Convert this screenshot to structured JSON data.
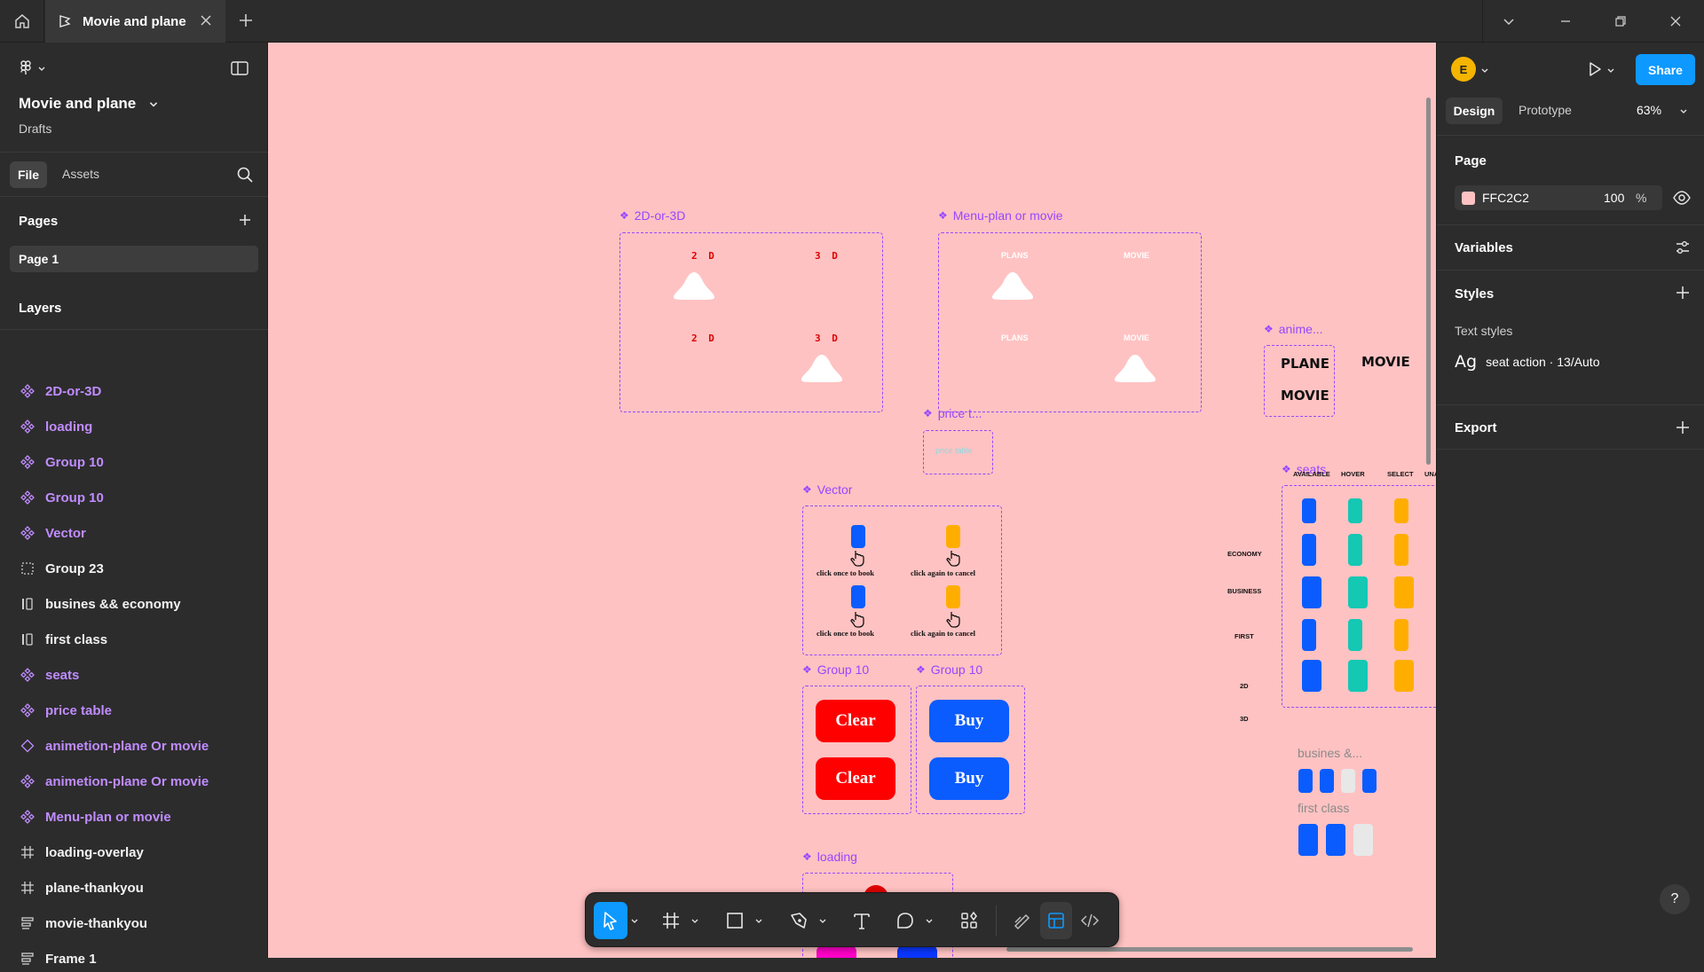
{
  "app": {
    "tab_title": "Movie and plane",
    "project_title": "Movie and plane",
    "project_location": "Drafts"
  },
  "left_panel": {
    "tabs": [
      "File",
      "Assets"
    ],
    "pages_heading": "Pages",
    "pages": [
      "Page 1"
    ],
    "layers_heading": "Layers",
    "layers": [
      {
        "name": "2D-or-3D",
        "icon": "component-icon",
        "color": "purple"
      },
      {
        "name": "loading",
        "icon": "component-icon",
        "color": "purple"
      },
      {
        "name": "Group 10",
        "icon": "component-icon",
        "color": "purple"
      },
      {
        "name": "Group 10",
        "icon": "component-icon",
        "color": "purple"
      },
      {
        "name": "Vector",
        "icon": "component-icon",
        "color": "purple"
      },
      {
        "name": "Group 23",
        "icon": "group-icon",
        "color": "white"
      },
      {
        "name": "busines && economy",
        "icon": "auto-layout-icon",
        "color": "white"
      },
      {
        "name": "first class",
        "icon": "auto-layout-icon",
        "color": "white"
      },
      {
        "name": "seats",
        "icon": "component-icon",
        "color": "purple"
      },
      {
        "name": "price table",
        "icon": "component-icon",
        "color": "purple"
      },
      {
        "name": "animetion-plane Or movie",
        "icon": "instance-icon",
        "color": "purple"
      },
      {
        "name": "animetion-plane Or movie",
        "icon": "component-icon",
        "color": "purple"
      },
      {
        "name": "Menu-plan or movie",
        "icon": "component-icon",
        "color": "purple"
      },
      {
        "name": "loading-overlay",
        "icon": "frame-icon",
        "color": "white"
      },
      {
        "name": "plane-thankyou",
        "icon": "frame-icon",
        "color": "white"
      },
      {
        "name": "movie-thankyou",
        "icon": "auto-layout-row-icon",
        "color": "white"
      },
      {
        "name": "Frame 1",
        "icon": "auto-layout-row-icon",
        "color": "white"
      }
    ]
  },
  "canvas": {
    "background": "#FFC2C2",
    "frames": {
      "twod": {
        "label": "2D-or-3D",
        "texts": [
          "2 D",
          "3 D",
          "2 D",
          "3 D"
        ]
      },
      "menu": {
        "label": "Menu-plan or movie",
        "texts": [
          "PLANS",
          "MOVIE",
          "PLANS",
          "MOVIE"
        ]
      },
      "anime": {
        "label": "anime...",
        "texts": [
          "PLANE",
          "MOVIE",
          "MOVIE"
        ]
      },
      "price": {
        "label": "price t...",
        "text": "price table"
      },
      "vector": {
        "label": "Vector",
        "captions": [
          "click once to book",
          "click again to cancel",
          "click once to book",
          "click again to cancel"
        ]
      },
      "group10a": {
        "label": "Group 10",
        "buttons": [
          "Clear",
          "Clear"
        ]
      },
      "group10b": {
        "label": "Group 10",
        "buttons": [
          "Buy",
          "Buy"
        ]
      },
      "seats": {
        "label": "seats",
        "columns": [
          "AVAILABLE",
          "HOVER",
          "SELECT",
          "UNAV"
        ],
        "rows": [
          "ECONOMY",
          "BUSINESS",
          "FIRST",
          "2D",
          "3D"
        ]
      },
      "busines": {
        "label": "busines &..."
      },
      "firstclass": {
        "label": "first class"
      },
      "loading": {
        "label": "loading"
      }
    }
  },
  "toolbar": {
    "tools": [
      "move-tool",
      "frame-tool",
      "shape-tool",
      "pen-tool",
      "text-tool",
      "comment-tool",
      "actions-tool",
      "draw-mode",
      "design-mode",
      "dev-mode"
    ]
  },
  "right_panel": {
    "avatar_initial": "E",
    "share_label": "Share",
    "tabs": [
      "Design",
      "Prototype"
    ],
    "zoom": "63%",
    "page_heading": "Page",
    "page_color_hex": "FFC2C2",
    "page_opacity": "100",
    "page_opacity_unit": "%",
    "variables_heading": "Variables",
    "styles_heading": "Styles",
    "text_styles_heading": "Text styles",
    "text_style_glyph": "Ag",
    "text_style_name": "seat action · 13/Auto",
    "export_heading": "Export",
    "help": "?"
  },
  "colors": {
    "accent": "#0d99ff",
    "component_purple": "#9747ff",
    "seat_blue": "#0a5cff",
    "seat_teal": "#14c8b4",
    "seat_orange": "#ffae00",
    "button_red": "#ff0000",
    "button_blue": "#0a5cff"
  }
}
